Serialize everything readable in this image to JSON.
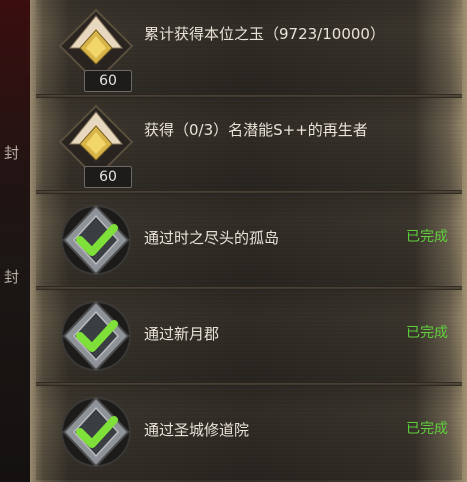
{
  "side_labels": [
    "封",
    "封"
  ],
  "tasks": [
    {
      "text": "累计获得本位之玉（9723/10000）",
      "level": "60",
      "status": "",
      "completed": false
    },
    {
      "text": "获得（0/3）名潜能S++的再生者",
      "level": "60",
      "status": "",
      "completed": false
    },
    {
      "text": "通过时之尽头的孤岛",
      "level": "",
      "status": "已完成",
      "completed": true
    },
    {
      "text": "通过新月郡",
      "level": "",
      "status": "已完成",
      "completed": true
    },
    {
      "text": "通过圣城修道院",
      "level": "",
      "status": "已完成",
      "completed": true
    }
  ],
  "colors": {
    "completed_status": "#5fcf3c",
    "gold_badge": "#d8b54a",
    "check_green": "#7fe03a"
  },
  "icons": {
    "pending": "gold-chevron-badge-icon",
    "completed": "green-check-badge-icon"
  }
}
